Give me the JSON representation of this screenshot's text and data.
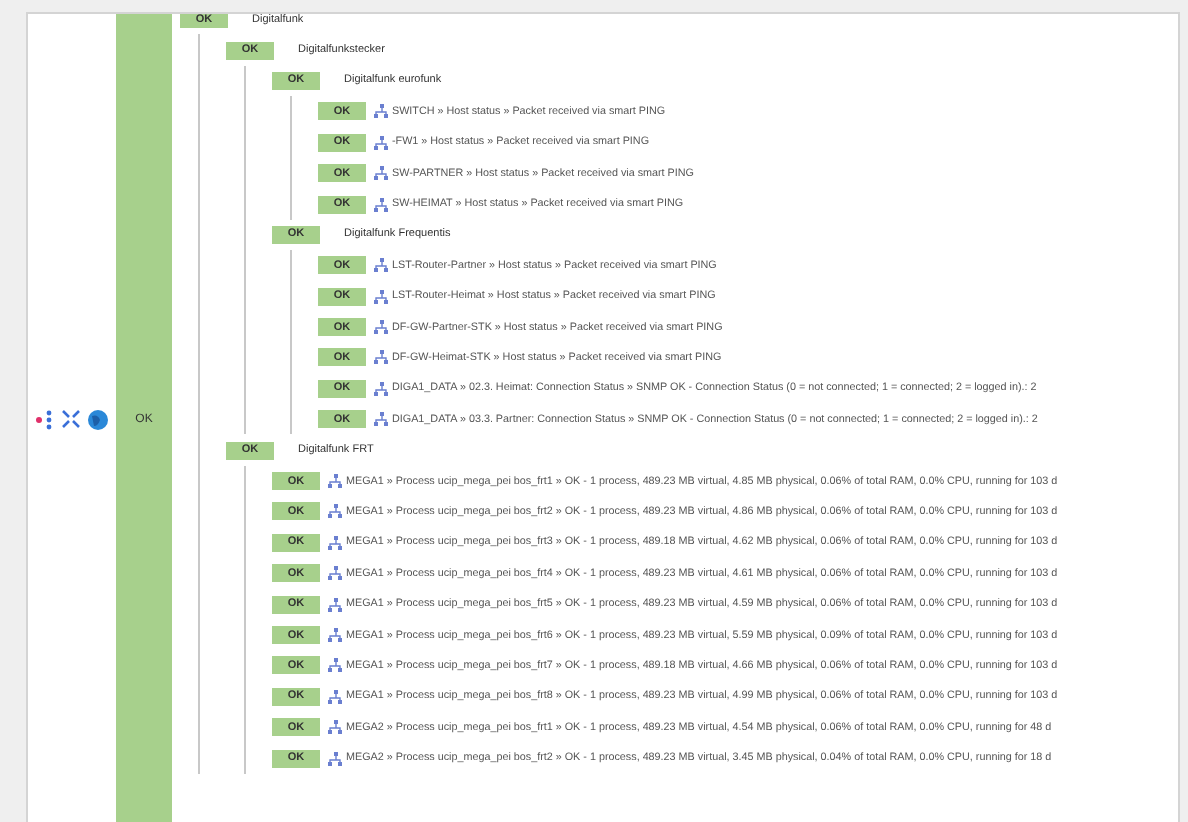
{
  "summary": {
    "state": "OK"
  },
  "tree": {
    "kind": "group",
    "state": "OK",
    "title": "Digitalfunk",
    "children": [
      {
        "kind": "group",
        "state": "OK",
        "title": "Digitalfunkstecker",
        "children": [
          {
            "kind": "group",
            "state": "OK",
            "title": "Digitalfunk eurofunk",
            "children": [
              {
                "kind": "service",
                "state": "OK",
                "text": "SWITCH » Host status » Packet received via smart PING"
              },
              {
                "kind": "service",
                "state": "OK",
                "text": "-FW1 » Host status » Packet received via smart PING"
              },
              {
                "kind": "service",
                "state": "OK",
                "text": "SW-PARTNER » Host status » Packet received via smart PING"
              },
              {
                "kind": "service",
                "state": "OK",
                "text": "SW-HEIMAT » Host status » Packet received via smart PING"
              }
            ]
          },
          {
            "kind": "group",
            "state": "OK",
            "title": "Digitalfunk Frequentis",
            "children": [
              {
                "kind": "service",
                "state": "OK",
                "text": "LST-Router-Partner » Host status » Packet received via smart PING"
              },
              {
                "kind": "service",
                "state": "OK",
                "text": "LST-Router-Heimat » Host status » Packet received via smart PING"
              },
              {
                "kind": "service",
                "state": "OK",
                "text": "DF-GW-Partner-STK » Host status » Packet received via smart PING"
              },
              {
                "kind": "service",
                "state": "OK",
                "text": "DF-GW-Heimat-STK » Host status » Packet received via smart PING"
              },
              {
                "kind": "service",
                "state": "OK",
                "text": "DIGA1_DATA » 02.3. Heimat: Connection Status » SNMP OK - Connection Status (0 = not connected; 1 = connected; 2 = logged in).: 2"
              },
              {
                "kind": "service",
                "state": "OK",
                "text": "DIGA1_DATA » 03.3. Partner: Connection Status » SNMP OK - Connection Status (0 = not connected; 1 = connected; 2 = logged in).: 2"
              }
            ]
          }
        ]
      },
      {
        "kind": "group",
        "state": "OK",
        "title": "Digitalfunk FRT",
        "children": [
          {
            "kind": "service",
            "state": "OK",
            "text": "MEGA1 » Process ucip_mega_pei bos_frt1 » OK - 1 process, 489.23 MB virtual, 4.85 MB physical, 0.06% of total RAM, 0.0% CPU, running for 103 d"
          },
          {
            "kind": "service",
            "state": "OK",
            "text": "MEGA1 » Process ucip_mega_pei bos_frt2 » OK - 1 process, 489.23 MB virtual, 4.86 MB physical, 0.06% of total RAM, 0.0% CPU, running for 103 d"
          },
          {
            "kind": "service",
            "state": "OK",
            "text": "MEGA1 » Process ucip_mega_pei bos_frt3 » OK - 1 process, 489.18 MB virtual, 4.62 MB physical, 0.06% of total RAM, 0.0% CPU, running for 103 d"
          },
          {
            "kind": "service",
            "state": "OK",
            "text": "MEGA1 » Process ucip_mega_pei bos_frt4 » OK - 1 process, 489.23 MB virtual, 4.61 MB physical, 0.06% of total RAM, 0.0% CPU, running for 103 d"
          },
          {
            "kind": "service",
            "state": "OK",
            "text": "MEGA1 » Process ucip_mega_pei bos_frt5 » OK - 1 process, 489.23 MB virtual, 4.59 MB physical, 0.06% of total RAM, 0.0% CPU, running for 103 d"
          },
          {
            "kind": "service",
            "state": "OK",
            "text": "MEGA1 » Process ucip_mega_pei bos_frt6 » OK - 1 process, 489.23 MB virtual, 5.59 MB physical, 0.09% of total RAM, 0.0% CPU, running for 103 d"
          },
          {
            "kind": "service",
            "state": "OK",
            "text": "MEGA1 » Process ucip_mega_pei bos_frt7 » OK - 1 process, 489.18 MB virtual, 4.66 MB physical, 0.06% of total RAM, 0.0% CPU, running for 103 d"
          },
          {
            "kind": "service",
            "state": "OK",
            "text": "MEGA1 » Process ucip_mega_pei bos_frt8 » OK - 1 process, 489.23 MB virtual, 4.99 MB physical, 0.06% of total RAM, 0.0% CPU, running for 103 d"
          },
          {
            "kind": "service",
            "state": "OK",
            "text": "MEGA2 » Process ucip_mega_pei bos_frt1 » OK - 1 process, 489.23 MB virtual, 4.54 MB physical, 0.06% of total RAM, 0.0% CPU, running for 48 d"
          },
          {
            "kind": "service",
            "state": "OK",
            "text": "MEGA2 » Process ucip_mega_pei bos_frt2 » OK - 1 process, 489.23 MB virtual, 3.45 MB physical, 0.04% of total RAM, 0.0% CPU, running for 18 d"
          }
        ]
      }
    ]
  }
}
